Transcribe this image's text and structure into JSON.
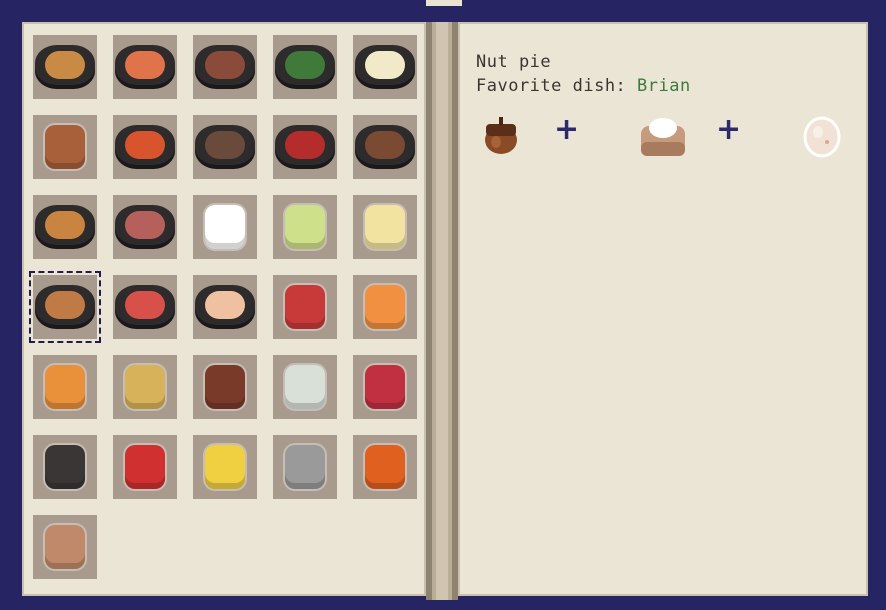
{
  "recipe": {
    "name": "Nut pie",
    "favorite_label": "Favorite dish:",
    "favorite_name": "Brian",
    "ingredients": [
      "acorn-icon",
      "flour-sack-icon",
      "egg-icon"
    ],
    "plus": "+"
  },
  "colors": {
    "book_border": "#262463",
    "page": "#ebe5d6",
    "slot": "#a89a8c",
    "favorite_name": "#3d7a3d",
    "plus": "#2e2a6a"
  },
  "dishes": [
    {
      "icon": "stuffed-potato-dish-icon",
      "food": "#c98a45"
    },
    {
      "icon": "salad-bowl-dish-icon",
      "food": "#e0734a"
    },
    {
      "icon": "steak-dish-icon",
      "food": "#8a4b3a"
    },
    {
      "icon": "veggie-salad-dish-icon",
      "food": "#3f7a3a"
    },
    {
      "icon": "fried-egg-dish-icon",
      "food": "#f2e9c8"
    },
    {
      "icon": "drumstick-icon",
      "food": "#a8603a"
    },
    {
      "icon": "tomato-soup-icon",
      "food": "#d8542c"
    },
    {
      "icon": "meat-stew-icon",
      "food": "#6a4a3a"
    },
    {
      "icon": "red-soup-icon",
      "food": "#b52c2c"
    },
    {
      "icon": "meatballs-dish-icon",
      "food": "#7a4a33"
    },
    {
      "icon": "taco-dish-icon",
      "food": "#c9853f"
    },
    {
      "icon": "ham-dish-icon",
      "food": "#b5605a"
    },
    {
      "icon": "coffee-mug-icon",
      "food": "#ffffff"
    },
    {
      "icon": "lemonade-glass-icon",
      "food": "#cfe08a"
    },
    {
      "icon": "milkshake-glass-icon",
      "food": "#f3e3a0"
    },
    {
      "icon": "nut-pie-icon",
      "food": "#c07a45"
    },
    {
      "icon": "cherry-cake-icon",
      "food": "#d8504a"
    },
    {
      "icon": "strawberry-cake-icon",
      "food": "#f0c1a0"
    },
    {
      "icon": "popsicle-icon",
      "food": "#c83a3a"
    },
    {
      "icon": "donut-icon",
      "food": "#f09040"
    },
    {
      "icon": "muffin-icon",
      "food": "#e8903a"
    },
    {
      "icon": "grain-sack-icon",
      "food": "#d8b25a"
    },
    {
      "icon": "honey-jar-icon",
      "food": "#7a3a2a"
    },
    {
      "icon": "pickle-jar-icon",
      "food": "#d8e0d8"
    },
    {
      "icon": "jam-jar-icon",
      "food": "#c03040"
    },
    {
      "icon": "coal-lump-icon",
      "food": "#3a3636"
    },
    {
      "icon": "red-potion-icon",
      "food": "#d03030"
    },
    {
      "icon": "oil-bottle-icon",
      "food": "#f0d040"
    },
    {
      "icon": "coffee-can-icon",
      "food": "#9a9a9a"
    },
    {
      "icon": "orange-potion-icon",
      "food": "#e06020"
    },
    {
      "icon": "flour-sack-icon",
      "food": "#c08a6a"
    }
  ]
}
